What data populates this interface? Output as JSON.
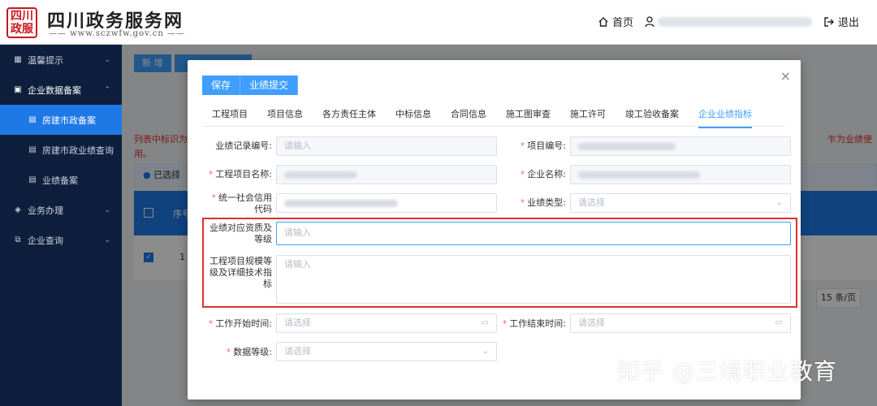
{
  "header": {
    "logo_chars": [
      "四",
      "川",
      "政",
      "服"
    ],
    "title": "四川政务服务网",
    "url": "—— www.sczwfw.gov.cn ——",
    "home": "首页",
    "logout": "退出",
    "icons": {
      "home": "home-icon",
      "user": "user-icon",
      "logout": "logout-icon"
    }
  },
  "sidebar": {
    "items": [
      {
        "label": "温馨提示",
        "icon": "grid-icon"
      },
      {
        "label": "企业数据备案",
        "icon": "book-icon"
      },
      {
        "label": "房建市政备案",
        "icon": "doc-icon"
      },
      {
        "label": "房建市政业绩查询",
        "icon": "doc-icon"
      },
      {
        "label": "业绩备案",
        "icon": "doc-icon"
      },
      {
        "label": "业务办理",
        "icon": "layers-icon"
      },
      {
        "label": "企业查询",
        "icon": "external-icon"
      }
    ]
  },
  "background": {
    "buttons": [
      "新 增"
    ],
    "notice_left": "列表中标识为",
    "notice_left2": "用。",
    "notice_right": "乍为业绩使",
    "selected_text": "已选择",
    "col_index": "序号",
    "row_index": "1",
    "pager": "15 条/页"
  },
  "modal": {
    "actions": {
      "save": "保存",
      "submit": "业绩提交"
    },
    "tabs": [
      "工程项目",
      "项目信息",
      "各方责任主体",
      "中标信息",
      "合同信息",
      "施工图审查",
      "施工许可",
      "竣工验收备案",
      "企业业绩指标"
    ],
    "active_tab": 8,
    "fields": {
      "record_no": {
        "label": "业绩记录编号:",
        "placeholder": "请输入"
      },
      "project_no": {
        "label": "项目编号:"
      },
      "project_name": {
        "label": "工程项目名称:"
      },
      "company_name": {
        "label": "企业名称:"
      },
      "credit_code": {
        "label_line1": "统一社会信用",
        "label_line2": "代码"
      },
      "perf_type": {
        "label": "业绩类型:",
        "placeholder": "请选择"
      },
      "qualification": {
        "label_line1": "业绩对应资质及",
        "label_line2": "等级",
        "placeholder": "请输入"
      },
      "scale": {
        "label_line1": "工程项目规模等",
        "label_line2": "级及详细技术指",
        "label_line3": "标",
        "placeholder": "请输入"
      },
      "start_time": {
        "label": "工作开始时间:",
        "placeholder": "请选择"
      },
      "end_time": {
        "label": "工作结束时间:",
        "placeholder": "请选择"
      },
      "data_level": {
        "label": "数据等级:",
        "placeholder": "请选择"
      }
    },
    "close": "×"
  },
  "watermark": "知乎 @三境职业教育",
  "colors": {
    "primary": "#409eff",
    "sidebar": "#0e1f3d",
    "active": "#1e78e6",
    "required": "#f56c6c",
    "highlight": "#e0302a"
  }
}
